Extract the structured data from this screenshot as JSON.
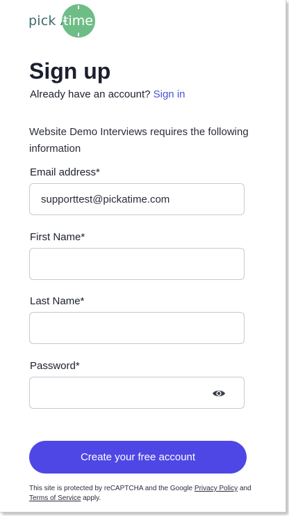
{
  "logo": {
    "pick": "pick A",
    "time": "time",
    "dash": "-"
  },
  "header": {
    "title": "Sign up",
    "have_account": "Already have an account?",
    "signin_link": "Sign in"
  },
  "info_text": "Website Demo Interviews requires the following information",
  "form": {
    "email_label": "Email address*",
    "email_value": "supporttest@pickatime.com",
    "first_name_label": "First Name*",
    "first_name_value": "",
    "last_name_label": "Last Name*",
    "last_name_value": "",
    "password_label": "Password*",
    "password_value": "",
    "submit_label": "Create your free account"
  },
  "legal": {
    "prefix": "This site is protected by reCAPTCHA and the Google",
    "privacy_link": "Privacy Policy",
    "and_text": "and",
    "terms_link": "Terms of Service",
    "suffix": "apply."
  },
  "icons": {
    "password_toggle": "eye-icon"
  },
  "colors": {
    "primary_button": "#4e47e5",
    "link": "#4a52d8",
    "logo_circle": "#6fbd86",
    "logo_text": "#3a6b6a",
    "heading": "#1b1f2e"
  }
}
